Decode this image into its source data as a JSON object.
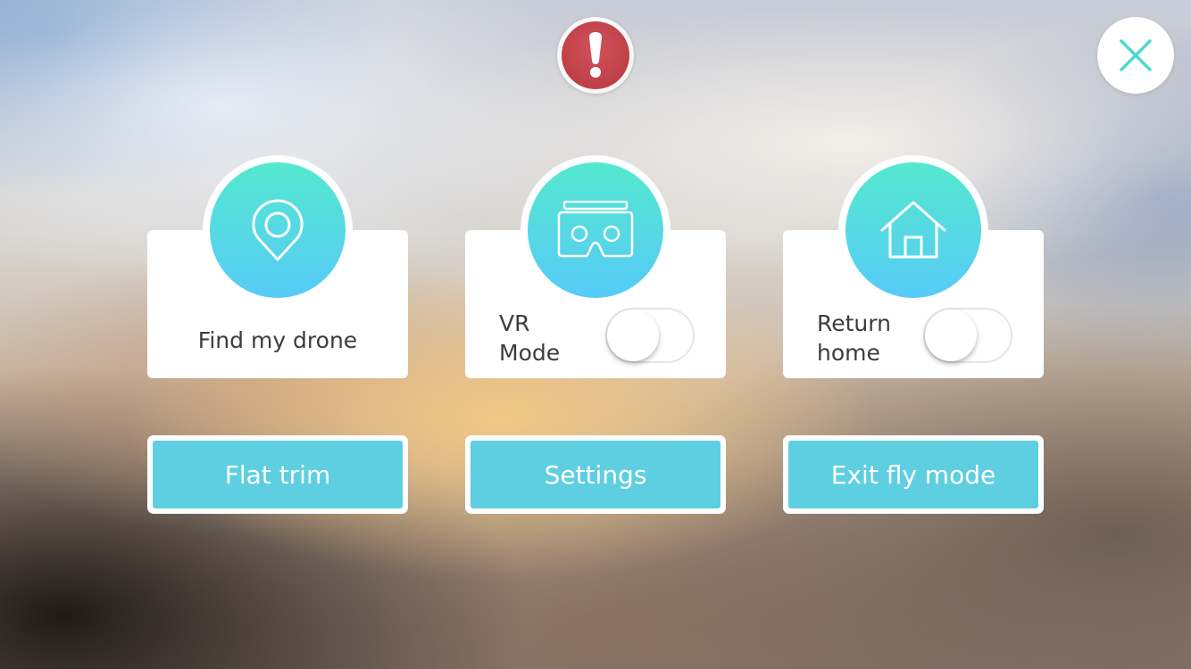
{
  "header": {
    "alert_icon": "exclamation-icon",
    "close_icon": "close-x-icon"
  },
  "cards": [
    {
      "icon": "location-pin-icon",
      "label": "Find my drone"
    },
    {
      "icon": "vr-headset-icon",
      "label_line1": "VR",
      "label_line2": "Mode",
      "toggle_on": false
    },
    {
      "icon": "home-icon",
      "label_line1": "Return",
      "label_line2": "home",
      "toggle_on": false
    }
  ],
  "actions": {
    "flat_trim": "Flat trim",
    "settings": "Settings",
    "exit_fly_mode": "Exit fly mode"
  },
  "colors": {
    "accent_gradient_top": "#55e8cf",
    "accent_gradient_bottom": "#56cbf7",
    "button_fill": "#5ecfe0",
    "alert_red": "#c2434a",
    "close_x": "#4fd8d0"
  }
}
